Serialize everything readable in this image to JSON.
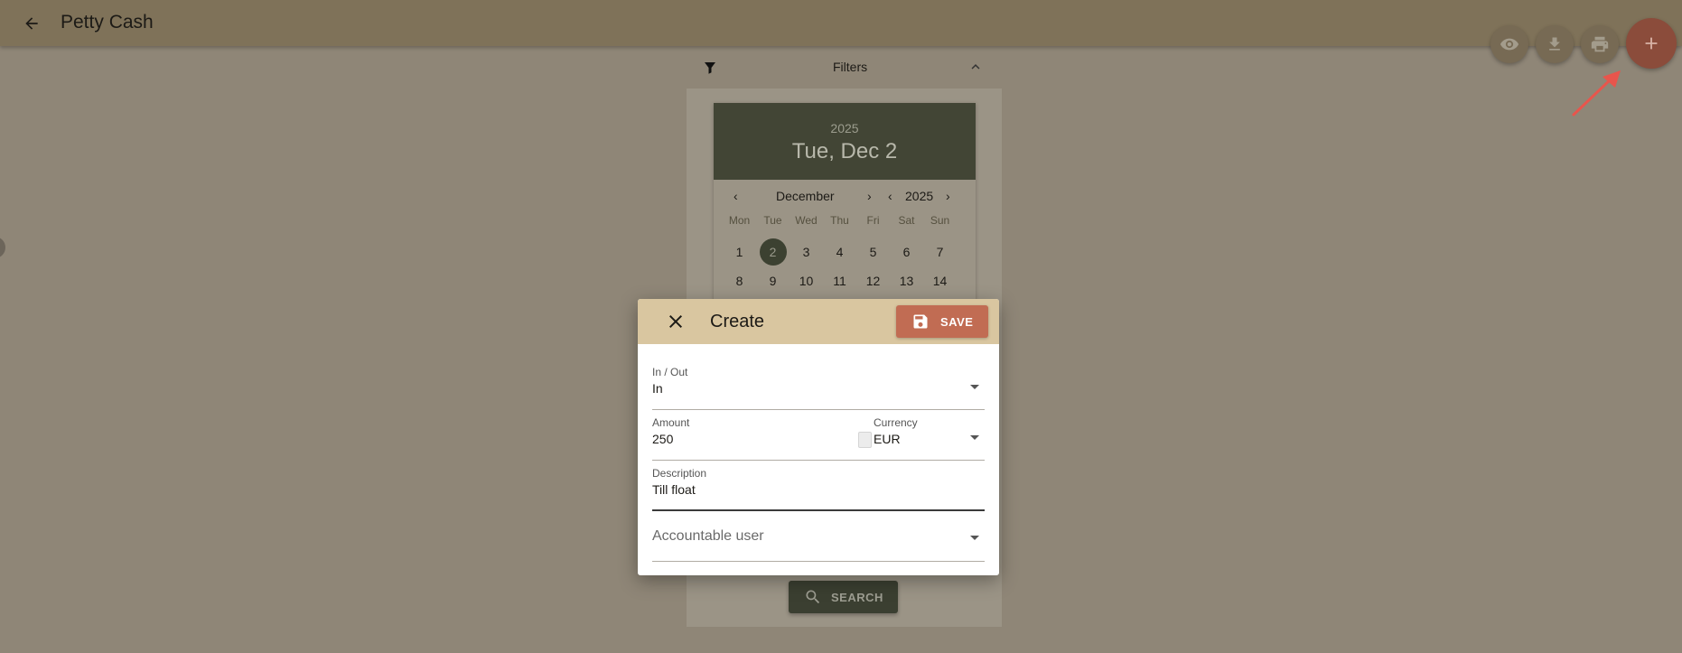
{
  "appbar": {
    "title": "Petty Cash",
    "back_icon": "arrow-left-icon"
  },
  "fabs": {
    "view_icon": "eye-icon",
    "download_icon": "download-icon",
    "print_icon": "printer-icon",
    "add_icon": "plus-icon",
    "add_label": "+"
  },
  "filters": {
    "label": "Filters",
    "filter_icon": "filter-icon",
    "collapse_icon": "chevron-up-icon"
  },
  "calendar": {
    "year": "2025",
    "selected_date": "Tue, Dec 2",
    "month": "December",
    "nav_year": "2025",
    "weekdays": [
      "Mon",
      "Tue",
      "Wed",
      "Thu",
      "Fri",
      "Sat",
      "Sun"
    ],
    "week1": [
      "1",
      "2",
      "3",
      "4",
      "5",
      "6",
      "7"
    ],
    "week2": [
      "8",
      "9",
      "10",
      "11",
      "12",
      "13",
      "14"
    ],
    "prev_symbol": "‹",
    "next_symbol": "›"
  },
  "search": {
    "label": "SEARCH",
    "icon": "search-icon"
  },
  "dialog": {
    "title": "Create",
    "close_icon": "close-icon",
    "save_label": "SAVE",
    "save_icon": "floppy-disk-icon",
    "in_out": {
      "label": "In / Out",
      "value": "In"
    },
    "amount": {
      "label": "Amount",
      "value": "250"
    },
    "currency": {
      "label": "Currency",
      "value": "EUR"
    },
    "description": {
      "label": "Description",
      "value": "Till float"
    },
    "accountable_user": {
      "placeholder": "Accountable user"
    }
  },
  "colors": {
    "appbar": "#7f7259",
    "dialog_header": "#d9c6a0",
    "save_button": "#c16c53",
    "add_fab": "#8b4c3b",
    "calendar_header": "#424535",
    "annotation_arrow": "#e8554c"
  }
}
